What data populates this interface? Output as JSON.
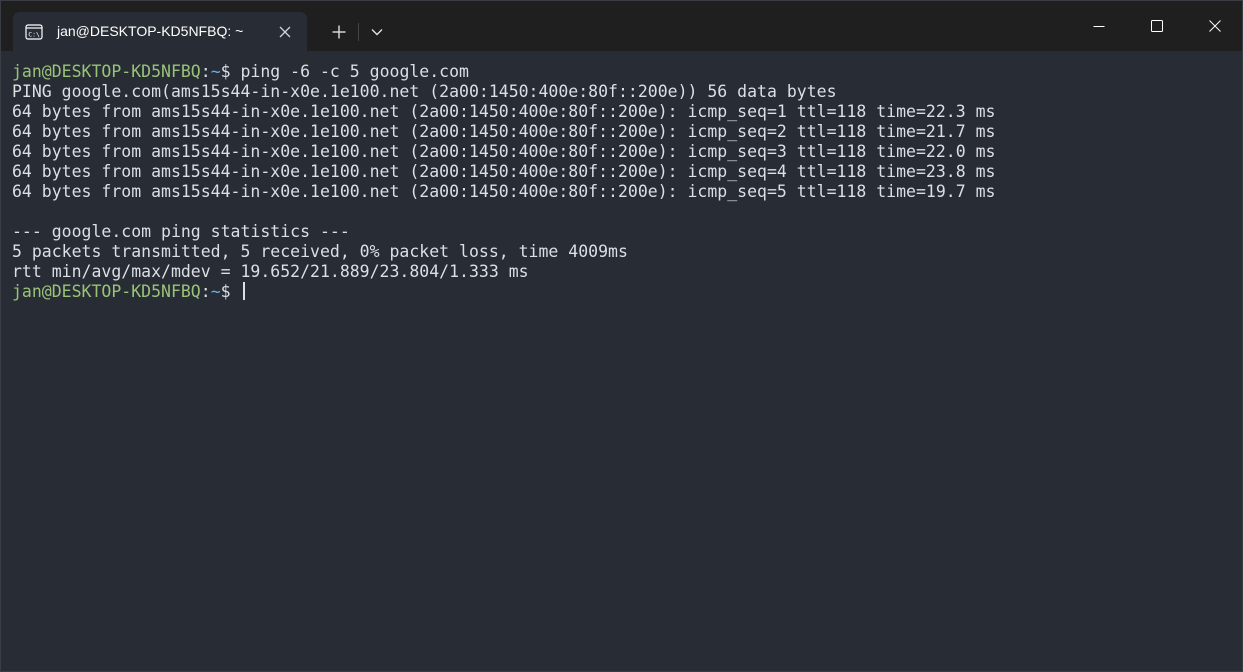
{
  "tab": {
    "title": "jan@DESKTOP-KD5NFBQ: ~",
    "icon": "terminal-icon"
  },
  "colors": {
    "user": "#98c379",
    "path": "#61afef",
    "text": "#dcdfe4",
    "background": "#282c34",
    "titlebar": "#1f1f1f"
  },
  "terminal": {
    "prompt_user": "jan@DESKTOP-KD5NFBQ",
    "prompt_sep": ":",
    "prompt_path": "~",
    "prompt_symbol": "$ ",
    "command": "ping -6 -c 5 google.com",
    "output": [
      "PING google.com(ams15s44-in-x0e.1e100.net (2a00:1450:400e:80f::200e)) 56 data bytes",
      "64 bytes from ams15s44-in-x0e.1e100.net (2a00:1450:400e:80f::200e): icmp_seq=1 ttl=118 time=22.3 ms",
      "64 bytes from ams15s44-in-x0e.1e100.net (2a00:1450:400e:80f::200e): icmp_seq=2 ttl=118 time=21.7 ms",
      "64 bytes from ams15s44-in-x0e.1e100.net (2a00:1450:400e:80f::200e): icmp_seq=3 ttl=118 time=22.0 ms",
      "64 bytes from ams15s44-in-x0e.1e100.net (2a00:1450:400e:80f::200e): icmp_seq=4 ttl=118 time=23.8 ms",
      "64 bytes from ams15s44-in-x0e.1e100.net (2a00:1450:400e:80f::200e): icmp_seq=5 ttl=118 time=19.7 ms",
      "",
      "--- google.com ping statistics ---",
      "5 packets transmitted, 5 received, 0% packet loss, time 4009ms",
      "rtt min/avg/max/mdev = 19.652/21.889/23.804/1.333 ms"
    ]
  }
}
